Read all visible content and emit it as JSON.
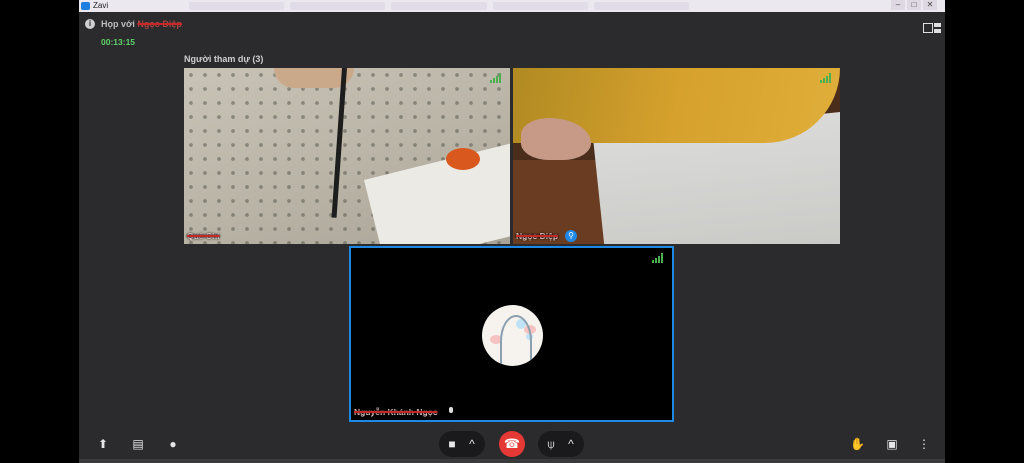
{
  "app": {
    "name": "Zavi"
  },
  "meeting": {
    "title_prefix": "Họp với",
    "title_name": "Ngọc Diệp",
    "timer": "00:13:15",
    "participants_label": "Người tham dự (3)"
  },
  "participants": [
    {
      "name": "Quế Chi",
      "signal": "strong"
    },
    {
      "name": "Ngọc Diệp",
      "signal": "strong",
      "pinned": true
    },
    {
      "name": "Nguyễn Khánh Ngọc",
      "signal": "strong",
      "active_speaker": true
    }
  ],
  "toolbar": {
    "left": [
      "share-screen-icon",
      "whiteboard-icon",
      "chat-icon"
    ],
    "center": [
      "camera-icon",
      "chevron-up-icon",
      "end-call-icon",
      "microphone-icon",
      "chevron-up-icon"
    ],
    "right": [
      "raise-hand-icon",
      "participants-icon",
      "more-options-icon"
    ]
  },
  "colors": {
    "background": "#2b2b2e",
    "end_call": "#e53935",
    "active_border": "#1e88e5",
    "timer": "#5fd06a",
    "signal": "#4caf50"
  }
}
